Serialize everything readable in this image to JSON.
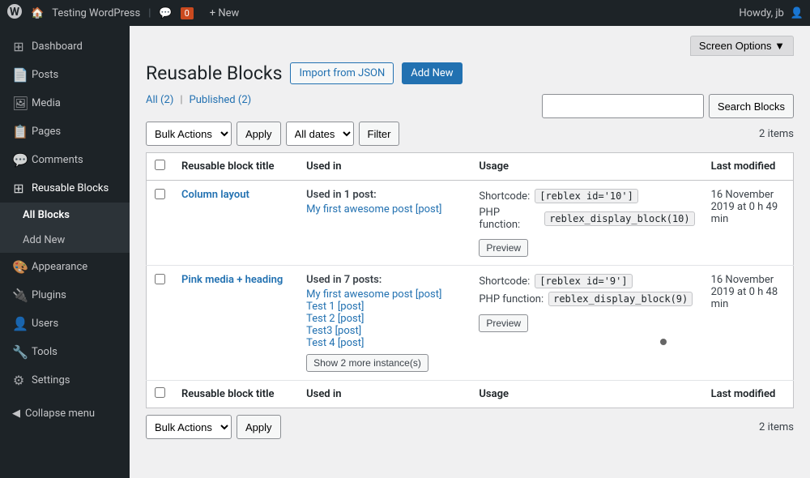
{
  "adminBar": {
    "siteName": "Testing WordPress",
    "commentsCount": "0",
    "newLabel": "+ New",
    "howdy": "Howdy, jb"
  },
  "screenOptions": {
    "label": "Screen Options ▼"
  },
  "sidebar": {
    "items": [
      {
        "id": "dashboard",
        "label": "Dashboard",
        "icon": "⊞"
      },
      {
        "id": "posts",
        "label": "Posts",
        "icon": "📄"
      },
      {
        "id": "media",
        "label": "Media",
        "icon": "🖼"
      },
      {
        "id": "pages",
        "label": "Pages",
        "icon": "📋"
      },
      {
        "id": "comments",
        "label": "Comments",
        "icon": "💬"
      },
      {
        "id": "reusable-blocks",
        "label": "Reusable Blocks",
        "icon": "⊞",
        "active": true
      }
    ],
    "submenu": [
      {
        "id": "all-blocks",
        "label": "All Blocks",
        "active": true
      },
      {
        "id": "add-new",
        "label": "Add New"
      }
    ],
    "otherItems": [
      {
        "id": "appearance",
        "label": "Appearance",
        "icon": "🎨"
      },
      {
        "id": "plugins",
        "label": "Plugins",
        "icon": "🔌"
      },
      {
        "id": "users",
        "label": "Users",
        "icon": "👤"
      },
      {
        "id": "tools",
        "label": "Tools",
        "icon": "🔧"
      },
      {
        "id": "settings",
        "label": "Settings",
        "icon": "⚙"
      }
    ],
    "collapseLabel": "Collapse menu"
  },
  "page": {
    "title": "Reusable Blocks",
    "importBtn": "Import from JSON",
    "addNewBtn": "Add New"
  },
  "filterLinks": {
    "all": "All",
    "allCount": "2",
    "published": "Published",
    "publishedCount": "2"
  },
  "filters": {
    "bulkActionsLabel": "Bulk Actions",
    "applyLabel": "Apply",
    "allDatesLabel": "All dates",
    "filterLabel": "Filter",
    "itemsCount": "2 items"
  },
  "search": {
    "placeholder": "",
    "buttonLabel": "Search Blocks"
  },
  "table": {
    "headers": {
      "title": "Reusable block title",
      "usedIn": "Used in",
      "usage": "Usage",
      "lastModified": "Last modified"
    },
    "rows": [
      {
        "id": 1,
        "title": "Column layout",
        "usedInLabel": "Used in 1 post:",
        "posts": [
          "My first awesome post [post]"
        ],
        "shortcodeLabel": "Shortcode:",
        "shortcode": "[reblex id='10']",
        "phpLabel": "PHP function:",
        "phpFunction": "reblex_display_block(10)",
        "previewBtn": "Preview",
        "lastModified": "16 November 2019 at 0 h 49 min"
      },
      {
        "id": 2,
        "title": "Pink media + heading",
        "usedInLabel": "Used in 7 posts:",
        "posts": [
          "My first awesome post [post]",
          "Test 1 [post]",
          "Test 2 [post]",
          "Test3 [post]",
          "Test 4 [post]"
        ],
        "showMoreBtn": "Show 2 more instance(s)",
        "shortcodeLabel": "Shortcode:",
        "shortcode": "[reblex id='9']",
        "phpLabel": "PHP function:",
        "phpFunction": "reblex_display_block(9)",
        "previewBtn": "Preview",
        "lastModified": "16 November 2019 at 0 h 48 min"
      }
    ]
  },
  "bottomBar": {
    "bulkActionsLabel": "Bulk Actions",
    "applyLabel": "Apply",
    "itemsCount": "2 items"
  }
}
